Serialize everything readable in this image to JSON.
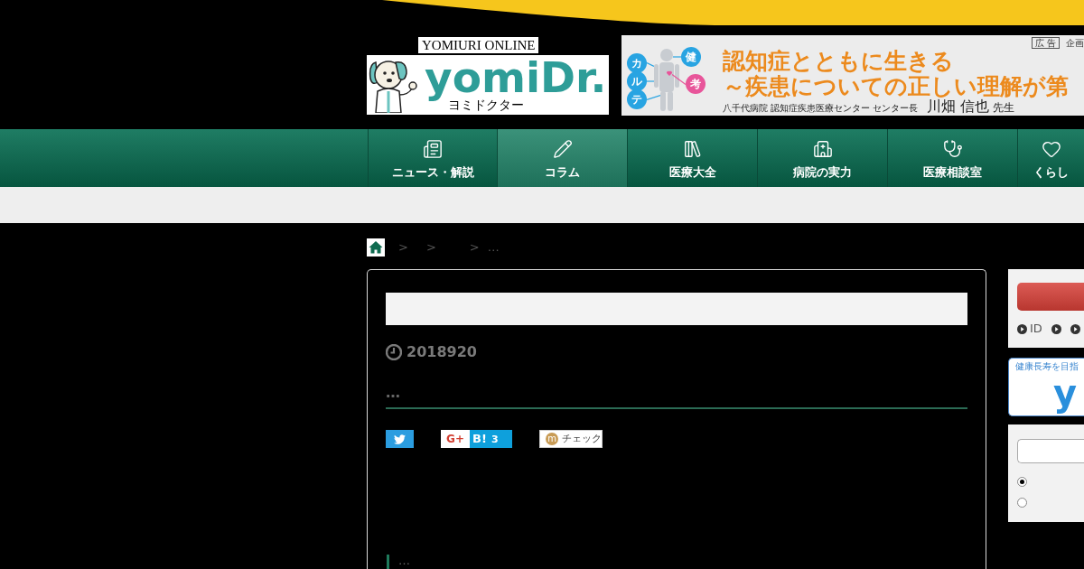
{
  "header": {
    "site_label": "YOMIURI ONLINE",
    "logo_name": "yomiDr.",
    "logo_reading": "ヨミドクター"
  },
  "ad_banner": {
    "badge": "広 告",
    "sponsor_note": "企画",
    "figure_labels": [
      {
        "text": "カ",
        "color": "#28a4e2"
      },
      {
        "text": "ル",
        "color": "#28a4e2"
      },
      {
        "text": "テ",
        "color": "#28a4e2"
      },
      {
        "text": "健",
        "color": "#28a4e2"
      },
      {
        "text": "考",
        "color": "#e8559a"
      }
    ],
    "headline": [
      "認知症とともに生きる",
      "～疾患についての正しい理解が第"
    ],
    "affiliation": "八千代病院 認知症疾患医療センター センター長",
    "doctor_name": "川畑 信也",
    "honorific": "先生"
  },
  "nav": [
    {
      "label": "ニュース・解説",
      "selected": false
    },
    {
      "label": "コラム",
      "selected": true
    },
    {
      "label": "医療大全",
      "selected": false
    },
    {
      "label": "病院の実力",
      "selected": false
    },
    {
      "label": "医療相談室",
      "selected": false
    },
    {
      "label": "くらし",
      "selected": false
    }
  ],
  "breadcrumb": {
    "separators": [
      ">",
      ">",
      ">"
    ],
    "trail_end": "…"
  },
  "article": {
    "date": "2018920",
    "lead": "…",
    "share_buttons": [
      {
        "kind": "bird"
      },
      {
        "kind": "plus",
        "label": "G+"
      },
      {
        "kind": "count",
        "label": "B!",
        "count": "3"
      },
      {
        "kind": "check",
        "mark": "m",
        "label": "チェック"
      }
    ],
    "section_heading": "…"
  },
  "sidebar": {
    "login_links": [
      {
        "kind": "link",
        "label": "ID"
      },
      {
        "kind": "bullet"
      },
      {
        "kind": "bullet"
      }
    ],
    "banner": {
      "tagline": "健康長寿を目指",
      "logo_letter": "y"
    },
    "search_options": [
      {
        "selected": true
      },
      {
        "selected": false
      }
    ]
  }
}
